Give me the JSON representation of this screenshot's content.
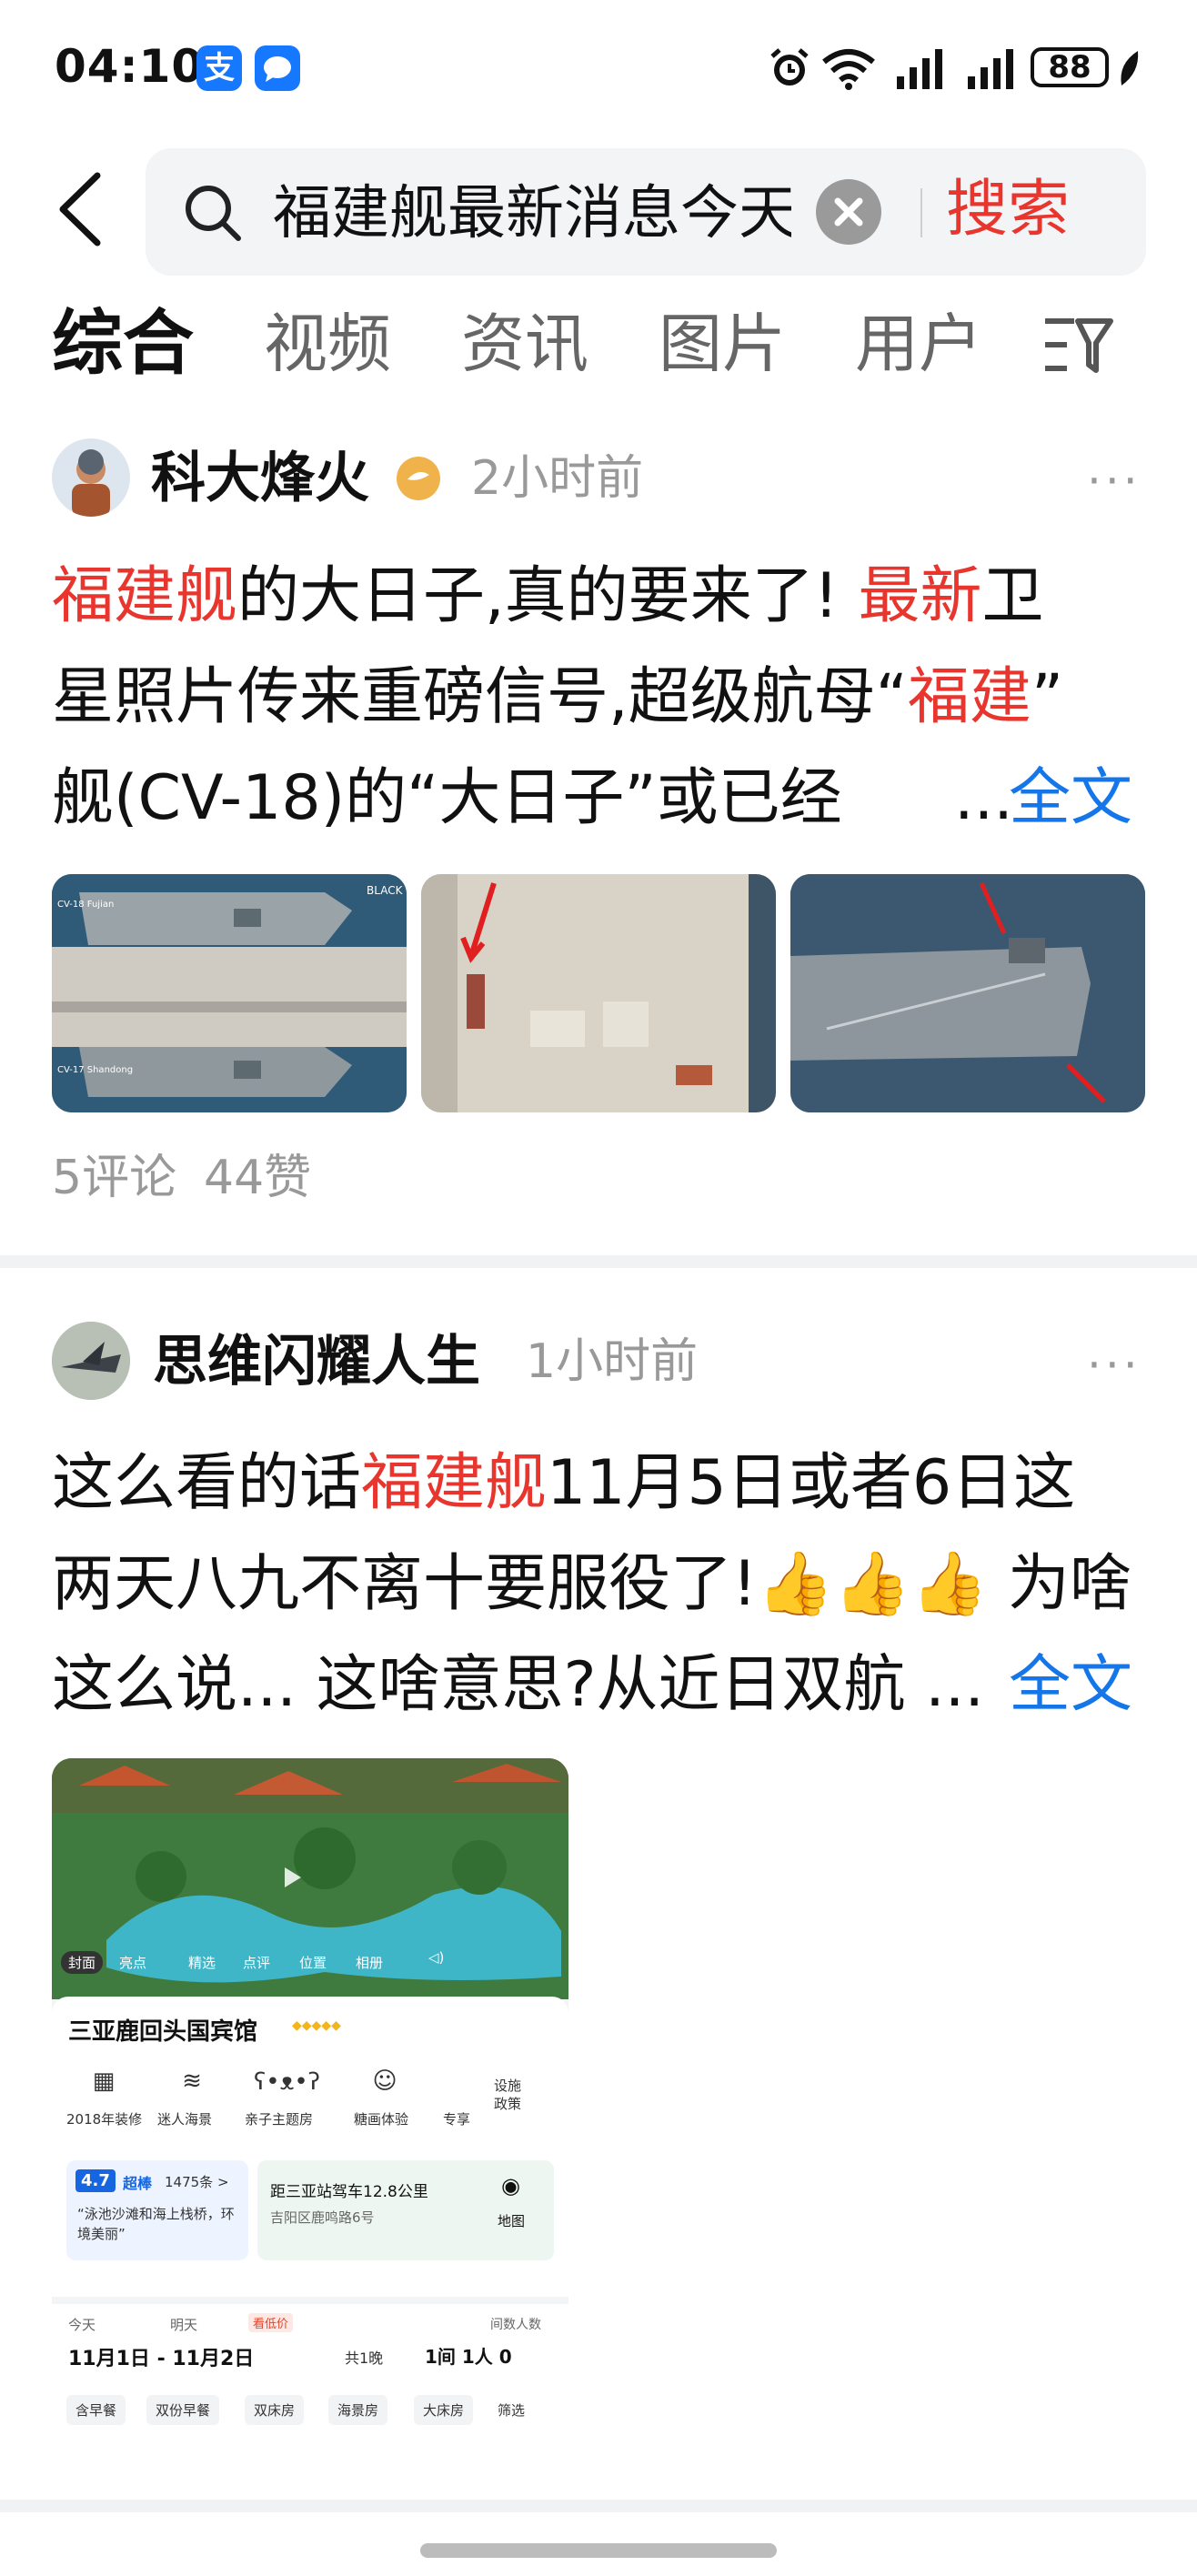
{
  "status_bar": {
    "time": "04:10",
    "app_icon_1": "支",
    "battery": "88"
  },
  "search": {
    "query": "福建舰最新消息今天",
    "button": "搜索"
  },
  "tabs": [
    "综合",
    "视频",
    "资讯",
    "图片",
    "用户"
  ],
  "posts": [
    {
      "author": "科大烽火",
      "time": "2小时前",
      "text_parts": [
        "福建舰",
        "的大日子,真的要来了! ",
        "最新",
        "卫",
        "星照片传来重磅信号,超级航母“",
        "福建",
        "”",
        "舰(CV-18)的“大日子”或已经",
        "...",
        "全文"
      ],
      "thumb_labels": [
        "BLACK",
        "CV-18 Fujian",
        "CV-17 Shandong"
      ],
      "comments": "5评论",
      "likes": "44赞"
    },
    {
      "author": "思维闪耀人生",
      "time": "1小时前",
      "text_parts": [
        "这么看的话",
        "福建舰",
        "11月5日或者6日这",
        "两天八九不离十要服役了!👍👍👍 为啥",
        "这么说... 这啥意思?从近日双航 ...",
        "全文"
      ],
      "hotel_card": {
        "media_tabs": [
          "封面",
          "亮点",
          "精选",
          "点评",
          "位置",
          "相册"
        ],
        "hotel_name": "三亚鹿回头国宾馆",
        "features": [
          "2018年装修",
          "迷人海景",
          "亲子主题房",
          "糖画体验",
          "专享"
        ],
        "policy": "设施政策",
        "rating": "4.7",
        "rating_label": "超棒",
        "review_count": "1475条 >",
        "review_quote": "“泳池沙滩和海上栈桥，环境美丽”",
        "distance": "距三亚站驾车12.8公里",
        "address": "吉阳区鹿鸣路6号",
        "map_label": "地图",
        "today": "今天",
        "tomorrow": "明天",
        "promo": "看低价",
        "date_range": "11月1日 - 11月2日",
        "nights": "共1晚",
        "guests_label": "间数人数",
        "guests": "1间 1人 0",
        "filters": [
          "含早餐",
          "双份早餐",
          "双床房",
          "海景房",
          "大床房",
          "筛选"
        ]
      }
    }
  ],
  "colors": {
    "highlight": "#e8352e",
    "link": "#1476e8",
    "muted": "#999999"
  }
}
